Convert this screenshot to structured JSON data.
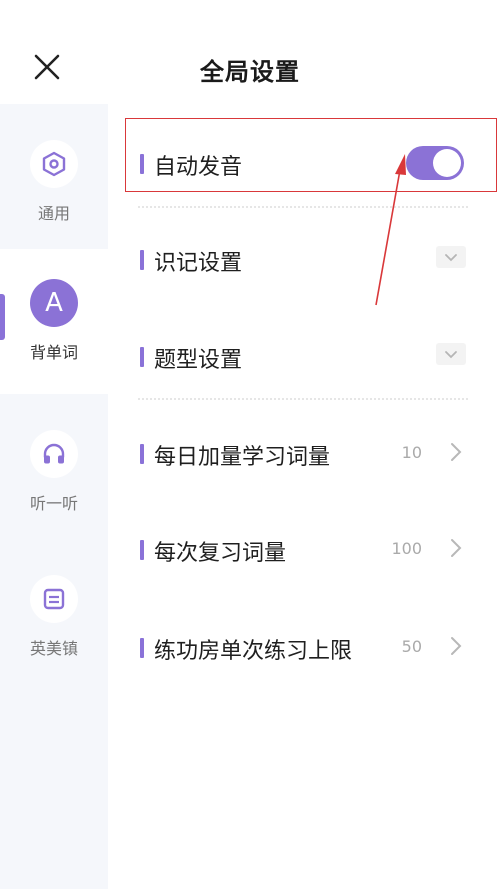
{
  "header": {
    "title": "全局设置",
    "close_icon": "close-icon"
  },
  "sidebar": {
    "items": [
      {
        "label": "通用",
        "icon": "settings-hexagon-icon",
        "active": false
      },
      {
        "label": "背单词",
        "icon": "letter-a-icon",
        "icon_text": "A",
        "active": true
      },
      {
        "label": "听一听",
        "icon": "headphones-icon",
        "active": false
      },
      {
        "label": "英美镇",
        "icon": "book-icon",
        "active": false
      }
    ]
  },
  "settings": [
    {
      "label": "自动发音",
      "control": "toggle",
      "toggle_on": true
    },
    {
      "label": "识记设置",
      "control": "dropdown"
    },
    {
      "label": "题型设置",
      "control": "dropdown"
    },
    {
      "label": "每日加量学习词量",
      "value": "10",
      "control": "chevron"
    },
    {
      "label": "每次复习词量",
      "value": "100",
      "control": "chevron"
    },
    {
      "label": "练功房单次练习上限",
      "value": "50",
      "control": "chevron"
    }
  ],
  "colors": {
    "accent": "#8b72d6",
    "highlight": "#d9383a",
    "sidebar_bg": "#f5f7fb"
  }
}
